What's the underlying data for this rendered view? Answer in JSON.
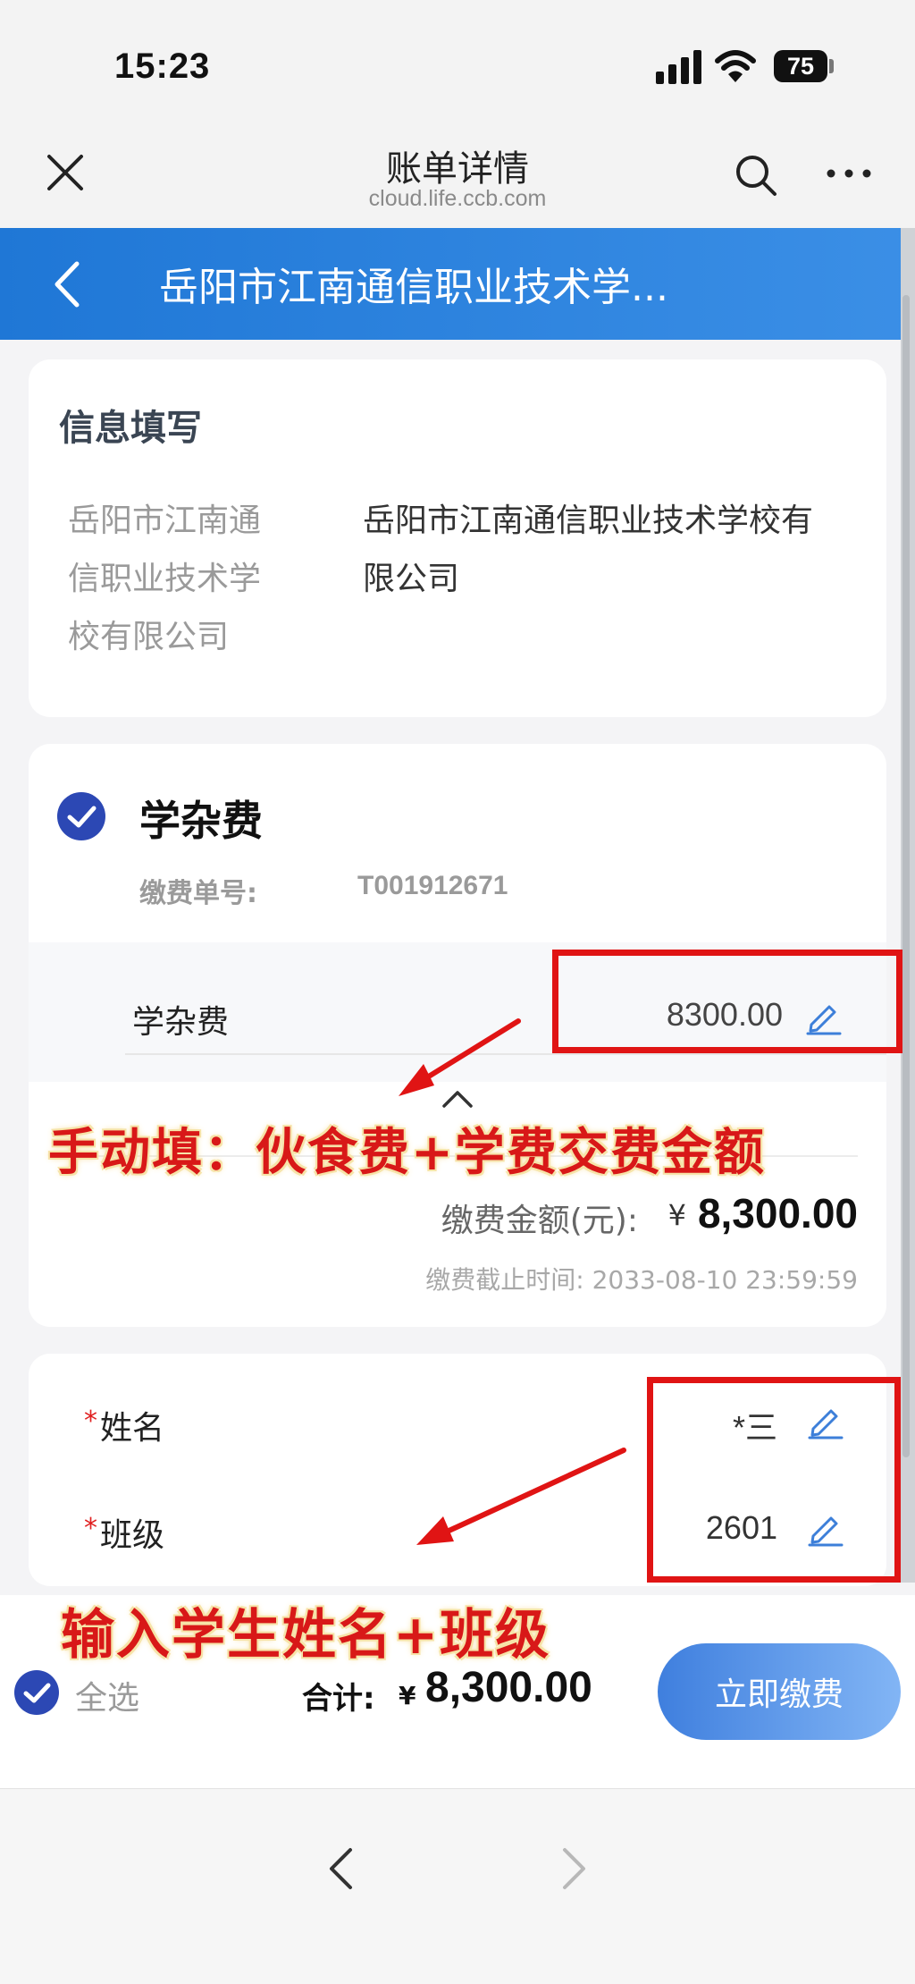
{
  "status_bar": {
    "time": "15:23",
    "battery": "75"
  },
  "browser": {
    "title": "账单详情",
    "url": "cloud.life.ccb.com"
  },
  "nav": {
    "title": "岳阳市江南通信职业技术学..."
  },
  "info_card": {
    "title": "信息填写",
    "label_lines": [
      "岳阳市江南通",
      "信职业技术学",
      "校有限公司"
    ],
    "value_lines": [
      "岳阳市江南通信职业技术学校有",
      "限公司"
    ]
  },
  "fee_card": {
    "title": "学杂费",
    "bill_no_label": "缴费单号:",
    "bill_no": "T001912671",
    "item_label": "学杂费",
    "item_amount": "8300.00",
    "amount_label": "缴费金额(元):",
    "currency": "¥",
    "amount": "8,300.00",
    "deadline": "缴费截止时间: 2033-08-10 23:59:59"
  },
  "form": {
    "required_mark": "*",
    "name_label": "姓名",
    "name_value": "*三",
    "class_label": "班级",
    "class_value": "2601"
  },
  "bottom": {
    "select_all": "全选",
    "total_label": "合计:",
    "currency": "¥",
    "total": "8,300.00",
    "pay_button": "立即缴费"
  },
  "annotations": {
    "text_1": "手动填：伙食费+学费交费金额",
    "text_2": "输入学生姓名+班级",
    "color": "#e01414"
  },
  "colors": {
    "nav_blue": "#1f77d6",
    "check_blue": "#2c48b4",
    "edit_blue": "#3d7fd9"
  }
}
